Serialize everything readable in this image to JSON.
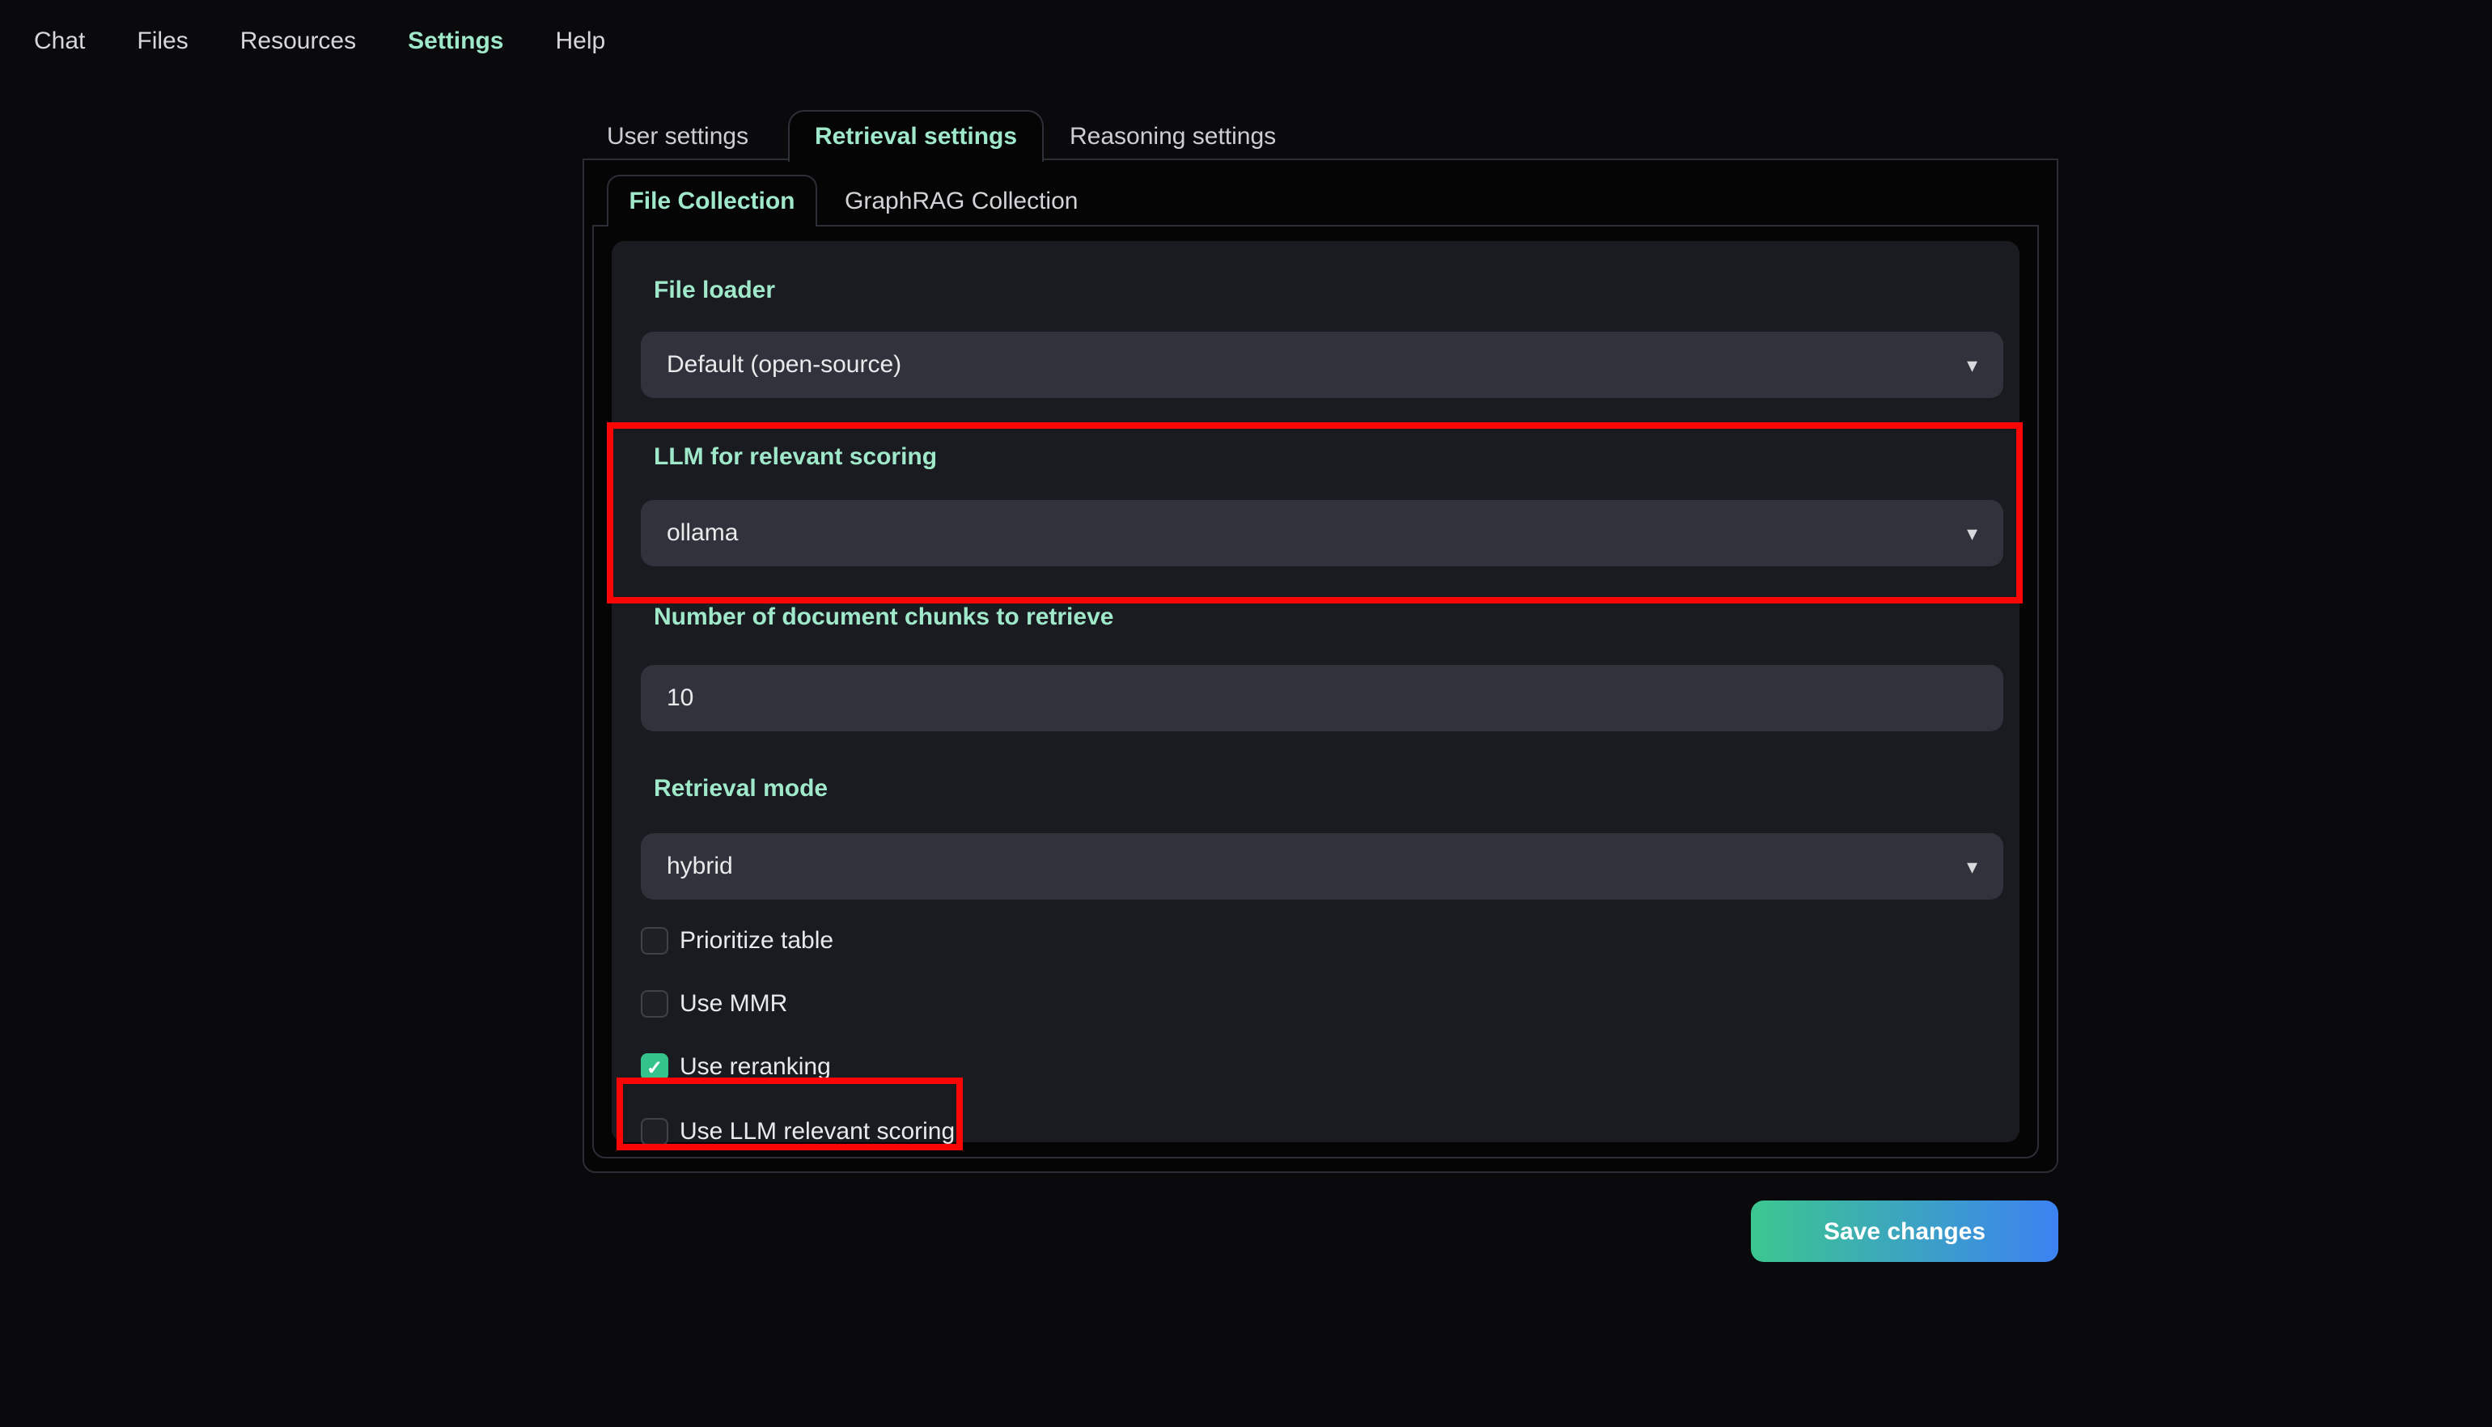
{
  "nav": {
    "items": [
      {
        "label": "Chat",
        "active": false
      },
      {
        "label": "Files",
        "active": false
      },
      {
        "label": "Resources",
        "active": false
      },
      {
        "label": "Settings",
        "active": true
      },
      {
        "label": "Help",
        "active": false
      }
    ]
  },
  "main_tabs": {
    "items": [
      {
        "label": "User settings",
        "active": false
      },
      {
        "label": "Retrieval settings",
        "active": true
      },
      {
        "label": "Reasoning settings",
        "active": false
      }
    ]
  },
  "collection_tabs": {
    "items": [
      {
        "label": "File Collection",
        "active": true
      },
      {
        "label": "GraphRAG Collection",
        "active": false
      }
    ]
  },
  "form": {
    "file_loader": {
      "label": "File loader",
      "value": "Default (open-source)"
    },
    "llm_scoring": {
      "label": "LLM for relevant scoring",
      "value": "ollama"
    },
    "num_chunks": {
      "label": "Number of document chunks to retrieve",
      "value": "10"
    },
    "retrieval_mode": {
      "label": "Retrieval mode",
      "value": "hybrid"
    },
    "checkboxes": [
      {
        "label": "Prioritize table",
        "checked": false
      },
      {
        "label": "Use MMR",
        "checked": false
      },
      {
        "label": "Use reranking",
        "checked": true
      },
      {
        "label": "Use LLM relevant scoring",
        "checked": false
      }
    ]
  },
  "actions": {
    "save_label": "Save changes"
  },
  "icons": {
    "check": "✓",
    "dropdown_arrow": "▾"
  },
  "colors": {
    "accent": "#9fe8ca",
    "highlight": "#fb0505",
    "checkbox-checked": "#35c38c",
    "grad-start": "#3cc78e",
    "grad-end": "#3c82f2"
  }
}
